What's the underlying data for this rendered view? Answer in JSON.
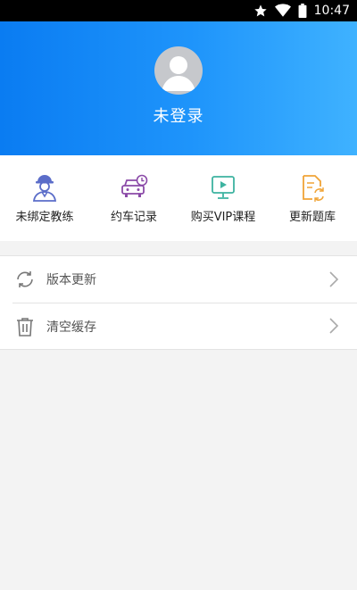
{
  "status_bar": {
    "time": "10:47"
  },
  "header": {
    "username": "未登录"
  },
  "quick_actions": [
    {
      "label": "未绑定教练",
      "icon": "coach-icon"
    },
    {
      "label": "约车记录",
      "icon": "car-booking-icon"
    },
    {
      "label": "购买VIP课程",
      "icon": "vip-course-icon"
    },
    {
      "label": "更新题库",
      "icon": "update-question-bank-icon"
    }
  ],
  "menu": [
    {
      "label": "版本更新",
      "icon": "refresh-icon"
    },
    {
      "label": "清空缓存",
      "icon": "trash-icon"
    }
  ],
  "colors": {
    "header_start": "#0a7cf2",
    "header_end": "#3fb2ff",
    "coach_icon": "#5b6dc9",
    "car_icon": "#8b4aa8",
    "vip_icon": "#3db3a0",
    "update_icon": "#f0a437"
  }
}
